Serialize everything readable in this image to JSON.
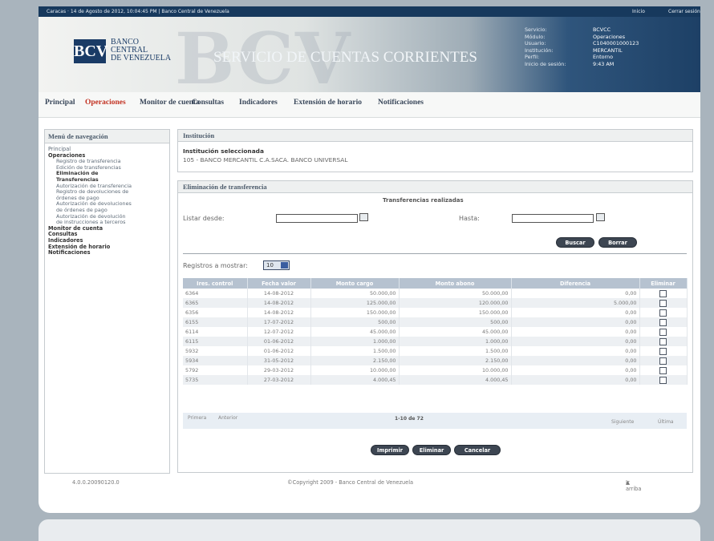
{
  "topbar": {
    "left": "Caracas · 14 de Agosto de 2012, 10:04:45 PM | Banco Central de Venezuela",
    "right1": "Inicio",
    "right2": "Cerrar sesión"
  },
  "header": {
    "logo": "BCV",
    "bank_lines": [
      "BANCO",
      "CENTRAL",
      "DE VENEZUELA"
    ],
    "service": "SERVICIO DE CUENTAS CORRIENTES",
    "watermark": "BCV",
    "info": [
      {
        "k": "Servicio:",
        "v": "BCVCC"
      },
      {
        "k": "Módulo:",
        "v": "Operaciones"
      },
      {
        "k": "Usuario:",
        "v": "C1040001000123"
      },
      {
        "k": "Institución:",
        "v": "MERCANTIL"
      },
      {
        "k": "Perfil:",
        "v": "Entorno"
      },
      {
        "k": "Inicio de sesión:",
        "v": "9:43 AM"
      }
    ]
  },
  "nav": [
    "Principal",
    "Operaciones",
    "Monitor de cuenta",
    "Consultas",
    "Indicadores",
    "Extensión de horario",
    "Notificaciones"
  ],
  "menu": {
    "title": "Menú de navegación",
    "items": [
      {
        "t": "Principal",
        "lvl": 0,
        "b": false
      },
      {
        "t": "Operaciones",
        "lvl": 0,
        "b": true
      },
      {
        "t": "Registro de transferencia",
        "lvl": 1,
        "b": false
      },
      {
        "t": "Edición de transferencias",
        "lvl": 1,
        "b": false
      },
      {
        "t": "Eliminación de",
        "lvl": 1,
        "b": true
      },
      {
        "t": "Transferencias",
        "lvl": 1,
        "b": true
      },
      {
        "t": "Autorización de transferencia",
        "lvl": 1,
        "b": false
      },
      {
        "t": "Registro de devoluciones de",
        "lvl": 1,
        "b": false
      },
      {
        "t": "órdenes de pago",
        "lvl": 1,
        "b": false
      },
      {
        "t": "Autorización de devoluciones",
        "lvl": 1,
        "b": false
      },
      {
        "t": "de órdenes de pago",
        "lvl": 1,
        "b": false
      },
      {
        "t": "Autorización de devolución",
        "lvl": 1,
        "b": false
      },
      {
        "t": "de instrucciones a terceros",
        "lvl": 1,
        "b": false
      },
      {
        "t": "Monitor de cuenta",
        "lvl": 0,
        "b": true
      },
      {
        "t": "Consultas",
        "lvl": 0,
        "b": true
      },
      {
        "t": "Indicadores",
        "lvl": 0,
        "b": true
      },
      {
        "t": "Extensión de horario",
        "lvl": 0,
        "b": true
      },
      {
        "t": "Notificaciones",
        "lvl": 0,
        "b": true
      }
    ]
  },
  "institucion": {
    "bar": "Institución",
    "label": "Institución seleccionada",
    "value": "105 - BANCO MERCANTIL C.A.SACA. BANCO UNIVERSAL"
  },
  "eliminacion": {
    "bar": "Eliminación de transferencia",
    "subtitle": "Transferencias realizadas",
    "desde": "Listar desde:",
    "hasta": "Hasta:",
    "buscar": "Buscar",
    "borrar": "Borrar",
    "registros": "Registros a mostrar:",
    "registros_val": "10",
    "columns": [
      "Ires. control",
      "Fecha valor",
      "Monto cargo",
      "Monto abono",
      "Diferencia",
      "Eliminar"
    ],
    "rows": [
      [
        "6364",
        "14-08-2012",
        "50.000,00",
        "50.000,00",
        "0,00"
      ],
      [
        "6365",
        "14-08-2012",
        "125.000,00",
        "120.000,00",
        "5.000,00"
      ],
      [
        "6356",
        "14-08-2012",
        "150.000,00",
        "150.000,00",
        "0,00"
      ],
      [
        "6155",
        "17-07-2012",
        "500,00",
        "500,00",
        "0,00"
      ],
      [
        "6114",
        "12-07-2012",
        "45.000,00",
        "45.000,00",
        "0,00"
      ],
      [
        "6115",
        "01-06-2012",
        "1.000,00",
        "1.000,00",
        "0,00"
      ],
      [
        "5932",
        "01-06-2012",
        "1.500,00",
        "1.500,00",
        "0,00"
      ],
      [
        "5934",
        "31-05-2012",
        "2.150,00",
        "2.150,00",
        "0,00"
      ],
      [
        "5792",
        "29-03-2012",
        "10.000,00",
        "10.000,00",
        "0,00"
      ],
      [
        "5735",
        "27-03-2012",
        "4.000,45",
        "4.000,45",
        "0,00"
      ]
    ],
    "pager": {
      "first": "Primera",
      "prev": "Anterior",
      "info": "1-10 de 72",
      "next": "Siguiente",
      "last": "Última"
    },
    "actions": [
      "Imprimir",
      "Eliminar",
      "Cancelar"
    ]
  },
  "footer": {
    "version": "4.0.0.20090120.0",
    "copyright": "©Copyright 2009 - Banco Central de Venezuela",
    "top": "Ir arriba"
  }
}
